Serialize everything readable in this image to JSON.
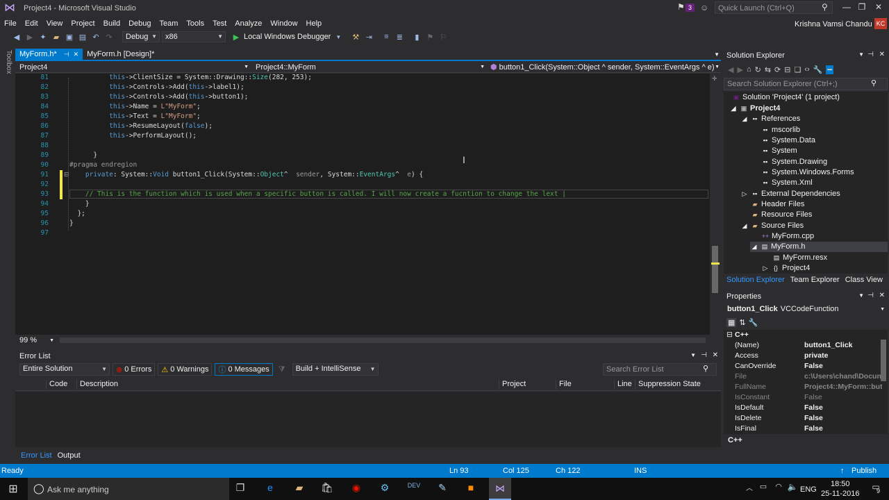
{
  "window": {
    "title": "Project4 - Microsoft Visual Studio",
    "notif_count": "3",
    "quick_launch": "Quick Launch (Ctrl+Q)",
    "user": "Krishna Vamsi Chandu",
    "avatar": "KC"
  },
  "menu": [
    "File",
    "Edit",
    "View",
    "Project",
    "Build",
    "Debug",
    "Team",
    "Tools",
    "Test",
    "Analyze",
    "Window",
    "Help"
  ],
  "toolbar": {
    "config": "Debug",
    "platform": "x86",
    "debugger": "Local Windows Debugger"
  },
  "toolbox_label": "Toolbox",
  "tabs": [
    {
      "label": "MyForm.h*"
    },
    {
      "label": "MyForm.h [Design]*"
    }
  ],
  "nav": {
    "project": "Project4",
    "class": "Project4::MyForm",
    "member": "button1_Click(System::Object ^ sender, System::EventArgs ^ e)"
  },
  "code": [
    {
      "n": "81",
      "t": "          this->ClientSize = System::Drawing::Size(282, 253);"
    },
    {
      "n": "82",
      "t": "          this->Controls->Add(this->label1);"
    },
    {
      "n": "83",
      "t": "          this->Controls->Add(this->button1);"
    },
    {
      "n": "84",
      "t": "          this->Name = L\"MyForm\";"
    },
    {
      "n": "85",
      "t": "          this->Text = L\"MyForm\";"
    },
    {
      "n": "86",
      "t": "          this->ResumeLayout(false);"
    },
    {
      "n": "87",
      "t": "          this->PerformLayout();"
    },
    {
      "n": "88",
      "t": ""
    },
    {
      "n": "89",
      "t": "      }"
    },
    {
      "n": "90",
      "t": "#pragma endregion"
    },
    {
      "n": "91",
      "t": "    private: System::Void button1_Click(System::Object^  sender, System::EventArgs^  e) {"
    },
    {
      "n": "92",
      "t": ""
    },
    {
      "n": "93",
      "t": "    // This is the function which is used when a specific button is called. I will now create a fucntion to change the lext |"
    },
    {
      "n": "94",
      "t": "    }"
    },
    {
      "n": "95",
      "t": "  };"
    },
    {
      "n": "96",
      "t": "}"
    },
    {
      "n": "97",
      "t": ""
    }
  ],
  "zoom": "99 %",
  "errorlist": {
    "title": "Error List",
    "scope": "Entire Solution",
    "errors": "0 Errors",
    "warnings": "0 Warnings",
    "messages": "0 Messages",
    "build": "Build + IntelliSense",
    "search": "Search Error List",
    "columns": [
      "Code",
      "Description",
      "Project",
      "File",
      "Line",
      "Suppression State"
    ]
  },
  "bottom_tabs": [
    "Error List",
    "Output"
  ],
  "solution_explorer": {
    "title": "Solution Explorer",
    "search": "Search Solution Explorer (Ctrl+;)",
    "tree": [
      "Solution 'Project4' (1 project)",
      "Project4",
      "References",
      "mscorlib",
      "System.Data",
      "System",
      "System.Drawing",
      "System.Windows.Forms",
      "System.Xml",
      "External Dependencies",
      "Header Files",
      "Resource Files",
      "Source Files",
      "MyForm.cpp",
      "MyForm.h",
      "MyForm.resx",
      "Project4"
    ],
    "tabs": [
      "Solution Explorer",
      "Team Explorer",
      "Class View"
    ]
  },
  "properties": {
    "title": "Properties",
    "selected": "button1_Click",
    "selected_type": "VCCodeFunction",
    "category": "C++",
    "rows": [
      [
        "(Name)",
        "button1_Click"
      ],
      [
        "Access",
        "private"
      ],
      [
        "CanOverride",
        "False"
      ],
      [
        "File",
        "c:\\Users\\chand\\Docun"
      ],
      [
        "FullName",
        "Project4::MyForm::but"
      ],
      [
        "IsConstant",
        "False"
      ],
      [
        "IsDefault",
        "False"
      ],
      [
        "IsDelete",
        "False"
      ],
      [
        "IsFinal",
        "False"
      ]
    ],
    "desc": "C++"
  },
  "status": {
    "ready": "Ready",
    "ln": "Ln 93",
    "col": "Col 125",
    "ch": "Ch 122",
    "ins": "INS",
    "publish": "Publish"
  },
  "taskbar": {
    "cortana": "Ask me anything",
    "lang": "ENG",
    "time": "18:50",
    "date": "25-11-2016",
    "notif": "9"
  }
}
